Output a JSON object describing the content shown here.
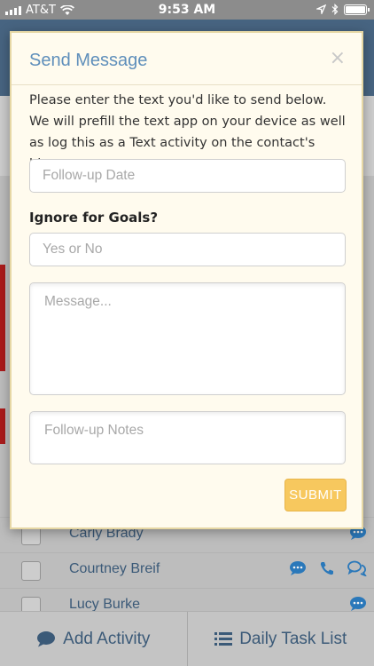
{
  "status_bar": {
    "carrier": "AT&T",
    "time": "9:53 AM"
  },
  "contacts": [
    {
      "name": "Carly Brady"
    },
    {
      "name": "Courtney Breif"
    },
    {
      "name": "Lucy Burke"
    }
  ],
  "bottom_bar": {
    "add_activity_label": "Add Activity",
    "daily_task_list_label": "Daily Task List"
  },
  "modal": {
    "title": "Send Message",
    "close_glyph": "×",
    "intro": "Please enter the text you'd like to send below. We will prefill the text app on your device as well as log this as a Text activity on the contact's history.",
    "follow_up_date_placeholder": "Follow-up Date",
    "ignore_goals_label": "Ignore for Goals?",
    "ignore_goals_placeholder": "Yes or No",
    "message_placeholder": "Message...",
    "follow_up_notes_placeholder": "Follow-up Notes",
    "submit_label": "SUBMIT"
  },
  "colors": {
    "modal_background": "#fffbee",
    "title": "#5f8fbb",
    "submit": "#f7c85e",
    "link": "#3f5f7f",
    "alert_red": "#b41e1e"
  },
  "icons": [
    "wifi-icon",
    "location-arrow-icon",
    "bluetooth-icon",
    "battery-icon",
    "chat-bubble-icon",
    "phone-icon",
    "conversation-icon",
    "list-icon",
    "close-icon"
  ]
}
